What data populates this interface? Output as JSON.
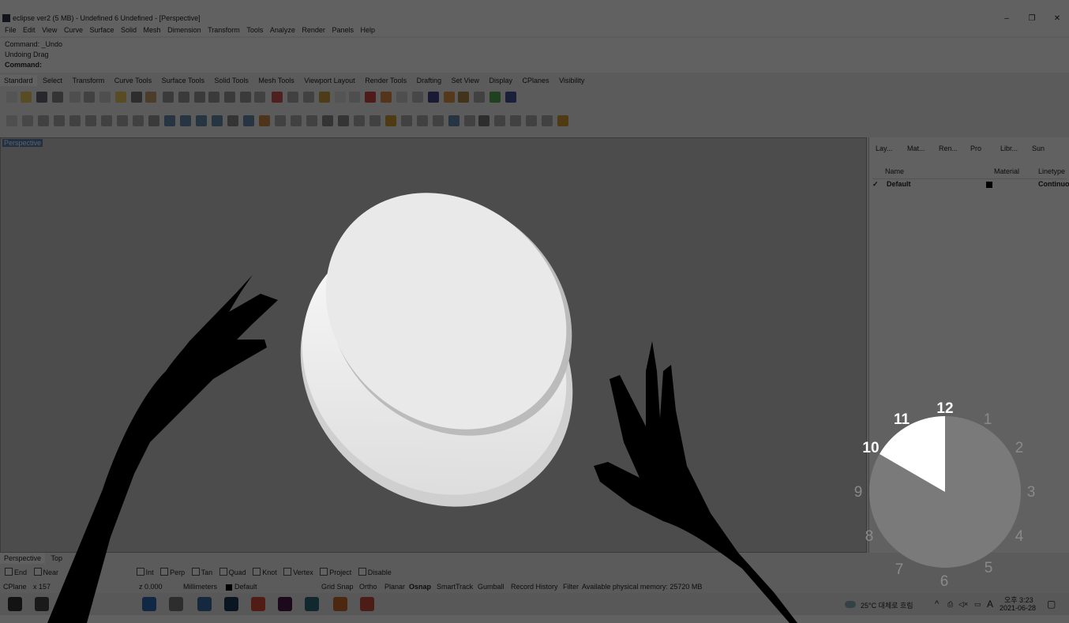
{
  "window": {
    "title": "eclipse ver2 (5 MB) - Undefined 6 Undefined - [Perspective]",
    "controls": [
      "–",
      "❐",
      "✕"
    ]
  },
  "menu": [
    "File",
    "Edit",
    "View",
    "Curve",
    "Surface",
    "Solid",
    "Mesh",
    "Dimension",
    "Transform",
    "Tools",
    "Analyze",
    "Render",
    "Panels",
    "Help"
  ],
  "command": {
    "history1": "Command: _Undo",
    "history2": "Undoing Drag",
    "prompt": "Command:"
  },
  "toolbar_tabs": [
    "Standard",
    "Select",
    "Transform",
    "Curve Tools",
    "Surface Tools",
    "Solid Tools",
    "Mesh Tools",
    "Viewport Layout",
    "Render Tools",
    "Drafting",
    "Set View",
    "Display",
    "CPlanes",
    "Visibility"
  ],
  "viewport": {
    "label": "Perspective",
    "tabs": [
      "Perspective",
      "Top"
    ]
  },
  "osnap": {
    "items": [
      "End",
      "Near",
      "Int",
      "Perp",
      "Tan",
      "Quad",
      "Knot",
      "Vertex",
      "Project",
      "Disable"
    ]
  },
  "statusbar": {
    "cplane": "CPlane",
    "x": "x 157",
    "z": "z 0.000",
    "units": "Millimeters",
    "layer": "Default",
    "toggles": [
      "Grid Snap",
      "Ortho",
      "Planar",
      "Osnap",
      "SmartTrack",
      "Gumball",
      "Record History",
      "Filter"
    ],
    "memory": "Available physical memory: 25720 MB"
  },
  "panel": {
    "tabs": [
      "Lay...",
      "Mat...",
      "Ren...",
      "Pro",
      "Libr...",
      "Sun"
    ],
    "columns": [
      "Name",
      "Material",
      "Linetype"
    ],
    "rows": [
      {
        "name": "Default",
        "linetype": "Continuou"
      }
    ]
  },
  "taskbar": {
    "weather": "25°C 대체로 흐림",
    "time": "오후 3:23",
    "date": "2021-06-28",
    "ime": "A"
  },
  "clock": {
    "numbers": [
      "12",
      "1",
      "2",
      "3",
      "4",
      "5",
      "6",
      "7",
      "8",
      "9",
      "10",
      "11"
    ],
    "highlighted": [
      "10",
      "11",
      "12"
    ]
  },
  "colors": {
    "accent": "#5b7fb0",
    "dim_overlay": "#000000"
  }
}
